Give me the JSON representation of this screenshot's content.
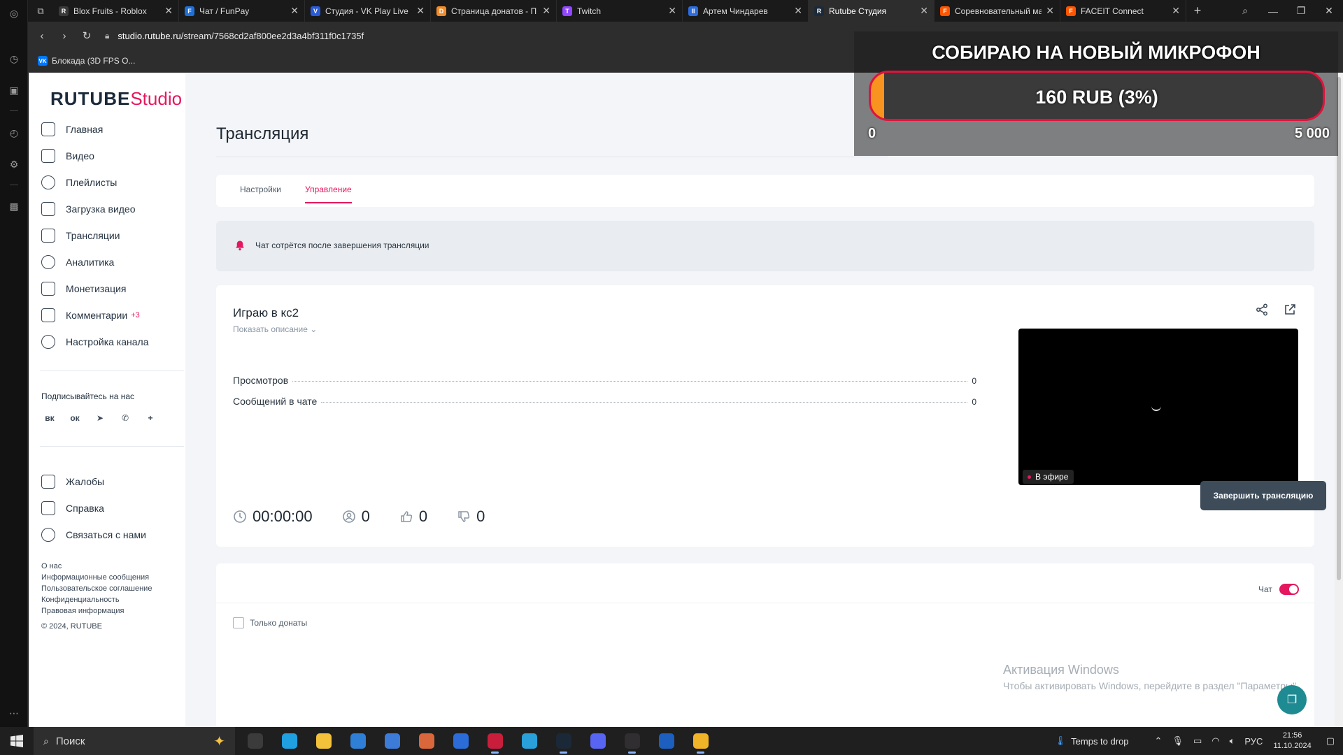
{
  "browser": {
    "tabs": [
      {
        "title": "Blox Fruits - Roblox",
        "color": "#3a3a3a",
        "glyph": "R",
        "active": false
      },
      {
        "title": "Чат / FunPay",
        "color": "#1f6fd8",
        "glyph": "F",
        "active": false
      },
      {
        "title": "Студия - VK Play Live",
        "color": "#2a5bd7",
        "glyph": "V",
        "active": false
      },
      {
        "title": "Страница донатов - П",
        "color": "#f28b2a",
        "glyph": "D",
        "active": false
      },
      {
        "title": "Twitch",
        "color": "#9146ff",
        "glyph": "T",
        "active": false
      },
      {
        "title": "Артем Чиндарев",
        "color": "#2d6cdf",
        "glyph": "II",
        "active": false
      },
      {
        "title": "Rutube Студия",
        "color": "#1b2a3a",
        "glyph": "R",
        "active": true
      },
      {
        "title": "Соревновательный ма",
        "color": "#ff5500",
        "glyph": "F",
        "active": false
      },
      {
        "title": "FACEIT Connect",
        "color": "#ff5500",
        "glyph": "F",
        "active": false
      }
    ],
    "url_domain": "studio.rutube.ru",
    "url_path": "/stream/7568cd2af800ee2d3a4bf311f0c1735f",
    "bookmark": "Блокада (3D FPS O..."
  },
  "overlay": {
    "title": "СОБИРАЮ НА НОВЫЙ МИКРОФОН",
    "amount": "160 RUB (3%)",
    "progress_percent": 3,
    "min": "0",
    "max": "5 000"
  },
  "sidebar": {
    "logo_main": "RUTUBE",
    "logo_accent": "Studio",
    "items": [
      {
        "label": "Главная",
        "icon": "home-icon"
      },
      {
        "label": "Видео",
        "icon": "video-icon"
      },
      {
        "label": "Плейлисты",
        "icon": "playlist-icon"
      },
      {
        "label": "Загрузка видео",
        "icon": "upload-icon"
      },
      {
        "label": "Трансляции",
        "icon": "broadcast-icon"
      },
      {
        "label": "Аналитика",
        "icon": "analytics-icon"
      },
      {
        "label": "Монетизация",
        "icon": "monetization-icon"
      },
      {
        "label": "Комментарии",
        "icon": "comments-icon",
        "badge": "+3"
      },
      {
        "label": "Настройка канала",
        "icon": "channel-settings-icon"
      }
    ],
    "follow_label": "Подписывайтесь на нас",
    "socials": [
      {
        "name": "vk-icon",
        "glyph": "вк"
      },
      {
        "name": "odnoklassniki-icon",
        "glyph": "ок"
      },
      {
        "name": "telegram-icon",
        "glyph": "➤"
      },
      {
        "name": "viber-icon",
        "glyph": "✆"
      },
      {
        "name": "plus-icon",
        "glyph": "+"
      }
    ],
    "secondary": [
      {
        "label": "Жалобы",
        "icon": "flag-icon"
      },
      {
        "label": "Справка",
        "icon": "help-icon"
      },
      {
        "label": "Связаться с нами",
        "icon": "contact-icon"
      }
    ],
    "footer_links": [
      "О нас",
      "Информационные сообщения",
      "Пользовательское соглашение",
      "Конфиденциальность",
      "Правовая информация"
    ],
    "copyright": "© 2024, RUTUBE"
  },
  "main": {
    "title": "Трансляция",
    "tabs": [
      {
        "label": "Настройки",
        "active": false
      },
      {
        "label": "Управление",
        "active": true
      }
    ],
    "alert": "Чат сотрётся после завершения трансляции",
    "stream": {
      "title": "Играю в кс2",
      "show_description": "Показать описание",
      "stats": [
        {
          "label": "Просмотров",
          "value": "0"
        },
        {
          "label": "Сообщений в чате",
          "value": "0"
        }
      ],
      "timer": "00:00:00",
      "viewers": "0",
      "likes": "0",
      "dislikes": "0",
      "live_label": "В эфире",
      "end_button": "Завершить трансляцию"
    },
    "chat": {
      "toggle_label": "Чат",
      "toggle_on": true,
      "only_donations": "Только донаты"
    }
  },
  "windows_watermark": {
    "line1": "Активация Windows",
    "line2": "Чтобы активировать Windows, перейдите в раздел \"Параметры\"."
  },
  "taskbar": {
    "search_placeholder": "Поиск",
    "weather": "Temps to drop",
    "language": "РУС",
    "time": "21:56",
    "date": "11.10.2024",
    "apps": [
      {
        "name": "task-view-icon",
        "color": "#3b3b3b",
        "run": false
      },
      {
        "name": "edge-icon",
        "color": "#1fa0e0",
        "run": false
      },
      {
        "name": "file-explorer-icon",
        "color": "#f3c13a",
        "run": false
      },
      {
        "name": "store-icon",
        "color": "#2f7fd6",
        "run": false
      },
      {
        "name": "mail-icon",
        "color": "#3d7bd9",
        "run": false
      },
      {
        "name": "photos-icon",
        "color": "#d9673b",
        "run": false
      },
      {
        "name": "app-icon",
        "color": "#2b6cd8",
        "run": false
      },
      {
        "name": "app-red-icon",
        "color": "#c81e3c",
        "run": true
      },
      {
        "name": "telegram-icon",
        "color": "#29a0da",
        "run": false
      },
      {
        "name": "steam-icon",
        "color": "#1b2838",
        "run": true
      },
      {
        "name": "discord-icon",
        "color": "#5865f2",
        "run": false
      },
      {
        "name": "obs-icon",
        "color": "#302e31",
        "run": true
      },
      {
        "name": "shield-app-icon",
        "color": "#1c5fbf",
        "run": false
      },
      {
        "name": "browser-app-icon",
        "color": "#f0b429",
        "run": true
      }
    ]
  }
}
